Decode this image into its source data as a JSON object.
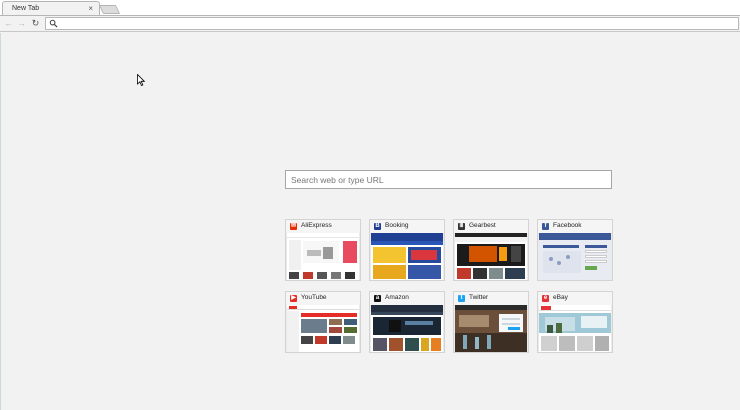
{
  "browser": {
    "tab": {
      "title": "New Tab",
      "close_glyph": "×"
    },
    "nav": {
      "back_glyph": "←",
      "forward_glyph": "→",
      "reload_glyph": "↻"
    },
    "address_bar": {
      "value": "",
      "icon": "search-icon"
    }
  },
  "search": {
    "placeholder": "Search web or type URL",
    "value": ""
  },
  "speed_dial": [
    {
      "name": "AliExpress",
      "icon": "aliexpress-icon",
      "icon_glyph": "✉",
      "icon_color": "#e62e04"
    },
    {
      "name": "Booking",
      "icon": "booking-icon",
      "icon_glyph": "B",
      "icon_color": "#1f3f93"
    },
    {
      "name": "Gearbest",
      "icon": "gearbest-icon",
      "icon_glyph": "Ⅲ",
      "icon_color": "#333333"
    },
    {
      "name": "Facebook",
      "icon": "facebook-icon",
      "icon_glyph": "f",
      "icon_color": "#3b5998"
    },
    {
      "name": "YouTube",
      "icon": "youtube-icon",
      "icon_glyph": "▶",
      "icon_color": "#e52d27"
    },
    {
      "name": "Amazon",
      "icon": "amazon-icon",
      "icon_glyph": "a",
      "icon_color": "#111111"
    },
    {
      "name": "Twitter",
      "icon": "twitter-icon",
      "icon_glyph": "t",
      "icon_color": "#1da1f2"
    },
    {
      "name": "eBay",
      "icon": "ebay-icon",
      "icon_glyph": "e",
      "icon_color": "#e53238"
    }
  ]
}
